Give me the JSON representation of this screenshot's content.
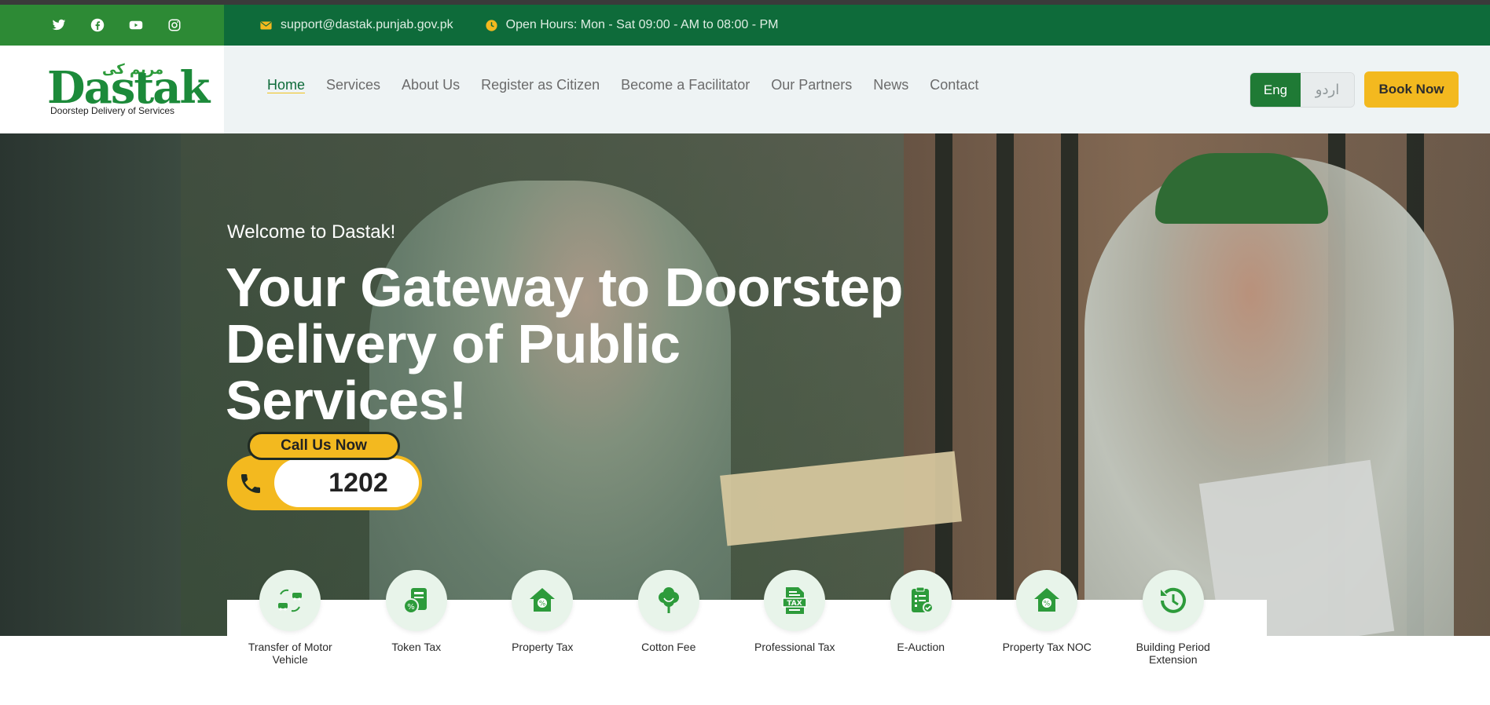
{
  "topbar": {
    "social": [
      {
        "icon": "twitter-icon"
      },
      {
        "icon": "facebook-icon"
      },
      {
        "icon": "youtube-icon"
      },
      {
        "icon": "instagram-icon"
      }
    ],
    "email": "support@dastak.punjab.gov.pk",
    "hours": "Open Hours: Mon - Sat 09:00 - AM to 08:00 - PM"
  },
  "header": {
    "logo": {
      "main": "Dastak",
      "urdu": "مریم کی",
      "tagline": "Doorstep Delivery of Services"
    },
    "nav": [
      "Home",
      "Services",
      "About Us",
      "Register as Citizen",
      "Become a Facilitator",
      "Our Partners",
      "News",
      "Contact"
    ],
    "lang_en": "Eng",
    "lang_ur": "اردو",
    "book_now": "Book Now"
  },
  "hero": {
    "welcome": "Welcome to Dastak!",
    "title": "Your Gateway to Doorstep Delivery of Public Services!",
    "call_label": "Call Us Now",
    "call_number": "1202"
  },
  "services": [
    {
      "label": "Transfer of Motor Vehicle",
      "icon": "vehicle-transfer-icon"
    },
    {
      "label": "Token Tax",
      "icon": "token-tax-icon"
    },
    {
      "label": "Property Tax",
      "icon": "property-tax-icon"
    },
    {
      "label": "Cotton Fee",
      "icon": "cotton-icon"
    },
    {
      "label": "Professional Tax",
      "icon": "tax-document-icon"
    },
    {
      "label": "E-Auction",
      "icon": "auction-checklist-icon"
    },
    {
      "label": "Property Tax NOC",
      "icon": "property-noc-icon"
    },
    {
      "label": "Building Period Extension",
      "icon": "history-icon"
    }
  ],
  "colors": {
    "brand_green": "#0e6b3a",
    "accent_yellow": "#f3b91f",
    "icon_green": "#2d9b3b"
  }
}
